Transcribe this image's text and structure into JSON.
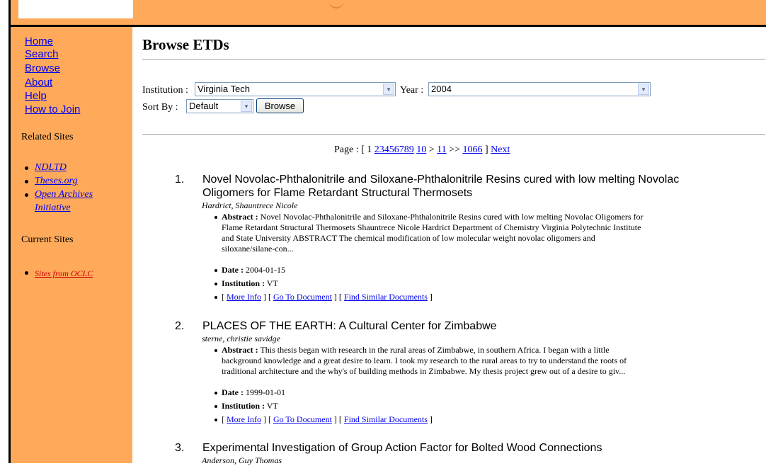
{
  "sidebar": {
    "nav": [
      "Home",
      "Search",
      "Browse",
      "About",
      "Help",
      "How to Join"
    ],
    "related_heading": "Related Sites",
    "related": [
      "NDLTD",
      "Theses.org",
      "Open Archives",
      "Initiative"
    ],
    "current_heading": "Current Sites",
    "current": [
      "Sites from OCLC"
    ]
  },
  "main": {
    "title": "Browse ETDs",
    "institution_label": "Institution :",
    "institution_value": "Virginia Tech",
    "year_label": "Year :",
    "year_value": "2004",
    "sortby_label": "Sort By :",
    "sortby_value": "Default",
    "browse_button": "Browse"
  },
  "pager": {
    "prefix": "Page : [",
    "current": "1",
    "pages": [
      "2",
      "3",
      "4",
      "5",
      "6",
      "7",
      "8",
      "9",
      "10"
    ],
    "gt": ">",
    "p11": "11",
    "dbl": ">>",
    "last": "1066",
    "close": "]",
    "next": "Next"
  },
  "results": [
    {
      "num": "1.",
      "title_line1": "Novel Novolac-Phthalonitrile and Siloxane-Phthalonitrile Resins cured with low melting Novolac",
      "title_line2": "Oligomers for Flame Retardant Structural Thermosets",
      "author": "Hardrict, Shauntrece Nicole",
      "abstract_label": "Abstract :",
      "abstract_lines": [
        " Novel Novolac-Phthalonitrile and Siloxane-Phthalonitrile Resins cured with low melting Novolac Oligomers for",
        "Flame Retardant Structural Thermosets Shauntrece Nicole Hardrict Department of Chemistry Virginia Polytechnic Institute",
        "and State University ABSTRACT The chemical modification of low molecular weight novolac oligomers and",
        "siloxane/silane-con..."
      ],
      "date_label": "Date :",
      "date": " 2004-01-15",
      "inst_label": "Institution :",
      "inst": " VT",
      "more_info": "More Info",
      "go_doc": "Go To Document",
      "similar": "Find Similar Documents"
    },
    {
      "num": "2.",
      "title_line1": "PLACES OF THE EARTH: A Cultural Center for Zimbabwe",
      "author": "sterne, christie savidge",
      "abstract_label": "Abstract :",
      "abstract_lines": [
        " This thesis began with research in the rural areas of Zimbabwe, in southern Africa. I began with a little",
        "background knowledge and a great desire to learn. I took my research to the rural areas to try to understand the roots of",
        "traditional architecture and the why's of building methods in Zimbabwe. My thesis project grew out of a desire to giv..."
      ],
      "date_label": "Date :",
      "date": " 1999-01-01",
      "inst_label": "Institution :",
      "inst": " VT",
      "more_info": "More Info",
      "go_doc": "Go To Document",
      "similar": "Find Similar Documents"
    },
    {
      "num": "3.",
      "title_line1": "Experimental Investigation of Group Action Factor for Bolted Wood Connections",
      "author": "Anderson, Guy Thomas"
    }
  ],
  "icons": {
    "dropdown": "chevron-down-icon",
    "dropdown_glyph": "▾"
  },
  "colors": {
    "sidebar_bg": "#ffaa5a",
    "link": "#0000ee"
  }
}
